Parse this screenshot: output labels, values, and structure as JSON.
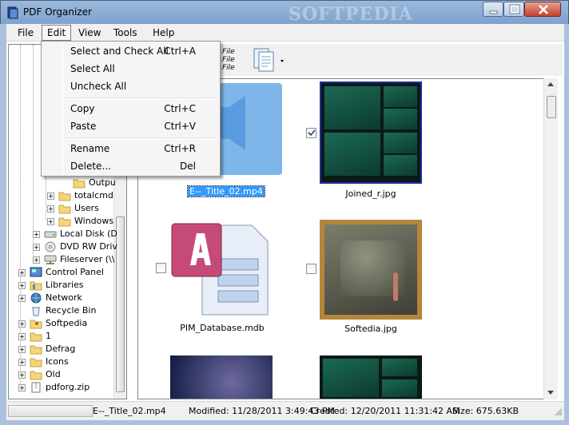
{
  "window": {
    "title": "PDF Organizer",
    "watermark": "SOFTPEDIA"
  },
  "menu": {
    "file": "File",
    "edit": "Edit",
    "view": "View",
    "tools": "Tools",
    "help": "Help"
  },
  "edit_menu": {
    "items": [
      {
        "label": "Select and Check All",
        "shortcut": "Ctrl+A"
      },
      {
        "label": "Select All",
        "shortcut": ""
      },
      {
        "label": "Uncheck All",
        "shortcut": ""
      },
      {
        "label": "Copy",
        "shortcut": "Ctrl+C"
      },
      {
        "label": "Paste",
        "shortcut": "Ctrl+V"
      },
      {
        "label": "Rename",
        "shortcut": "Ctrl+R"
      },
      {
        "label": "Delete...",
        "shortcut": "Del"
      }
    ]
  },
  "toolbar": {
    "file_label_1": "File",
    "file_label_2": "File",
    "file_label_3": "File"
  },
  "tree": {
    "items": [
      {
        "label": "Outpu",
        "icon": "folder-icon"
      },
      {
        "label": "totalcmd",
        "icon": "folder-icon"
      },
      {
        "label": "Users",
        "icon": "folder-icon"
      },
      {
        "label": "Windows",
        "icon": "folder-icon"
      },
      {
        "label": "Local Disk (D",
        "icon": "drive-icon"
      },
      {
        "label": "DVD RW Driv",
        "icon": "dvd-icon"
      },
      {
        "label": "Fileserver (\\\\",
        "icon": "network-drive-icon"
      },
      {
        "label": "Control Panel",
        "icon": "control-panel-icon"
      },
      {
        "label": "Libraries",
        "icon": "libraries-icon"
      },
      {
        "label": "Network",
        "icon": "network-icon"
      },
      {
        "label": "Recycle Bin",
        "icon": "recycle-bin-icon"
      },
      {
        "label": "Softpedia",
        "icon": "user-folder-icon"
      },
      {
        "label": "1",
        "icon": "folder-icon"
      },
      {
        "label": "Defrag",
        "icon": "folder-icon"
      },
      {
        "label": "Icons",
        "icon": "folder-icon"
      },
      {
        "label": "Old",
        "icon": "folder-icon"
      },
      {
        "label": "pdforg.zip",
        "icon": "zip-icon"
      }
    ]
  },
  "thumbnails": [
    {
      "name": "E--_Title_02.mp4",
      "selected": true,
      "checked": false
    },
    {
      "name": "Joined_r.jpg",
      "selected": false,
      "checked": true
    },
    {
      "name": "PIM_Database.mdb",
      "selected": false,
      "checked": false
    },
    {
      "name": "Softedia.jpg",
      "selected": false,
      "checked": false
    },
    {
      "name": "",
      "selected": false,
      "checked": false
    },
    {
      "name": "",
      "selected": false,
      "checked": false
    }
  ],
  "status": {
    "filename": "E--_Title_02.mp4",
    "modified": "Modified: 11/28/2011 3:49:43 PM",
    "created": "Created: 12/20/2011 11:31:42 AM",
    "size": "Size: 675.63KB"
  },
  "colors": {
    "selection": "#3399ff",
    "titlebar": "#9bb9dc",
    "close_button": "#c5412d"
  }
}
